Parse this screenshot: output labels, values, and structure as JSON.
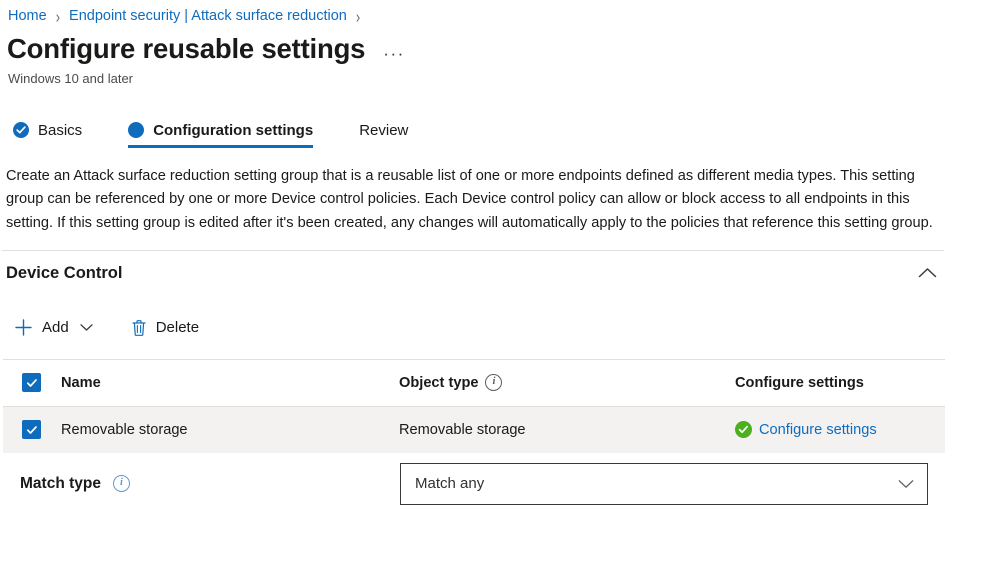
{
  "breadcrumb": {
    "items": [
      {
        "label": "Home"
      },
      {
        "label": "Endpoint security | Attack surface reduction"
      }
    ],
    "separator": "›"
  },
  "header": {
    "title": "Configure reusable settings",
    "more_menu": "···",
    "subtitle": "Windows 10 and later"
  },
  "tabs": [
    {
      "label": "Basics",
      "state": "completed",
      "icon": "check-circle-icon"
    },
    {
      "label": "Configuration settings",
      "state": "active",
      "icon": "filled-circle-icon"
    },
    {
      "label": "Review",
      "state": "default",
      "icon": "none"
    }
  ],
  "description": "Create an Attack surface reduction setting group that is a reusable list of one or more endpoints defined as different media types. This setting group can be referenced by one or more Device control policies. Each Device control policy can allow or block access to all endpoints in this setting. If this setting group is edited after it's been created, any changes will automatically apply to the policies that reference this setting group.",
  "section": {
    "title": "Device Control",
    "collapse_icon": "chevron-up-icon"
  },
  "command_bar": {
    "add_label": "Add",
    "add_icon": "plus-icon",
    "add_caret_icon": "chevron-down-icon",
    "delete_label": "Delete",
    "delete_icon": "trash-icon"
  },
  "table": {
    "columns": [
      {
        "key": "select",
        "label": ""
      },
      {
        "key": "name",
        "label": "Name"
      },
      {
        "key": "object_type",
        "label": "Object type",
        "info": true
      },
      {
        "key": "configure",
        "label": "Configure settings"
      }
    ],
    "header_select_all_checked": true,
    "rows": [
      {
        "checked": true,
        "name": "Removable storage",
        "object_type": "Removable storage",
        "configure_label": "Configure settings",
        "configure_status": "valid",
        "selected": true
      }
    ]
  },
  "match_type": {
    "label": "Match type",
    "info": true,
    "value": "Match any",
    "chevron_icon": "chevron-down-icon"
  },
  "colors": {
    "accent_blue": "#0f6cbd",
    "link_blue": "#0f6cbd",
    "status_green": "#4caf1c",
    "row_selected": "#f3f2f1",
    "divider": "#e1dfdd",
    "text": "#1b1a19"
  }
}
